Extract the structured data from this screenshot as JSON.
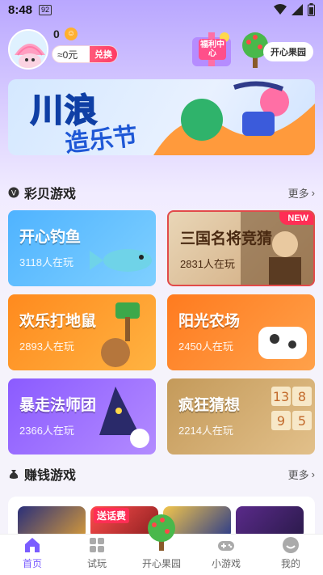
{
  "status": {
    "time": "8:48",
    "sim_badge": "92"
  },
  "header": {
    "coins": "0",
    "balance": "≈0元",
    "exchange_label": "兑换",
    "welfare_label": "福利中心",
    "orchard_label": "开心果园"
  },
  "banner": {
    "title": "川浪",
    "subtitle": "造乐节"
  },
  "sections": {
    "caibei": {
      "title": "彩贝游戏",
      "more": "更多"
    },
    "earn": {
      "title": "赚钱游戏",
      "more": "更多"
    }
  },
  "games": [
    {
      "name": "开心钓鱼",
      "players": "3118人在玩",
      "color_from": "#4fb3ff",
      "color_to": "#7fd0ff"
    },
    {
      "name": "三国名将竞猜",
      "players": "2831人在玩",
      "badge": "NEW",
      "color_from": "#e9d6b7",
      "color_to": "#cfa77a"
    },
    {
      "name": "欢乐打地鼠",
      "players": "2893人在玩",
      "color_from": "#ff8a1e",
      "color_to": "#ffb341"
    },
    {
      "name": "阳光农场",
      "players": "2450人在玩",
      "color_from": "#ff7b1f",
      "color_to": "#ffa14a"
    },
    {
      "name": "暴走法师团",
      "players": "2366人在玩",
      "color_from": "#8b5bff",
      "color_to": "#b38bff"
    },
    {
      "name": "疯狂猜想",
      "players": "2214人在玩",
      "color_from": "#c49a5a",
      "color_to": "#e2c08a"
    }
  ],
  "earn_preview": {
    "tag": "送话费"
  },
  "nav": [
    {
      "label": "首页",
      "icon": "home-icon",
      "active": true
    },
    {
      "label": "试玩",
      "icon": "grid-icon"
    },
    {
      "label": "开心果园",
      "icon": "tree-icon"
    },
    {
      "label": "小游戏",
      "icon": "gamepad-icon"
    },
    {
      "label": "我的",
      "icon": "smiley-icon"
    }
  ],
  "colors": {
    "accent": "#7a5cff",
    "exchange": "#ff3b63"
  }
}
